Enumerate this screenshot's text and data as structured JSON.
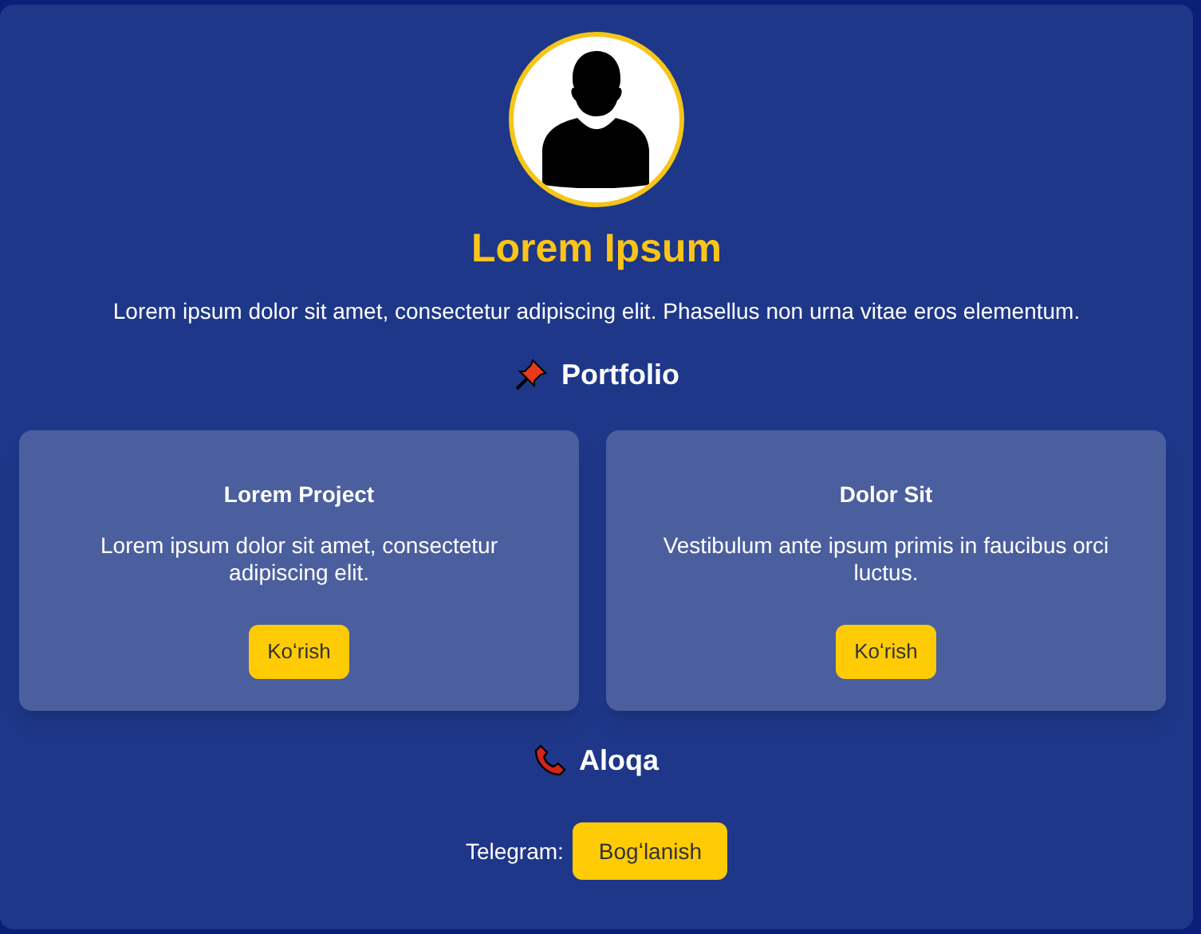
{
  "profile": {
    "name": "Lorem Ipsum",
    "bio": "Lorem ipsum dolor sit amet, consectetur adipiscing elit. Phasellus non urna vitae eros elementum."
  },
  "portfolio": {
    "heading": "Portfolio",
    "projects": [
      {
        "title": "Lorem Project",
        "description": "Lorem ipsum dolor sit amet, consectetur adipiscing elit.",
        "button": "Koʻrish"
      },
      {
        "title": "Dolor Sit",
        "description": "Vestibulum ante ipsum primis in faucibus orci luctus.",
        "button": "Koʻrish"
      }
    ]
  },
  "contact": {
    "heading": "Aloqa",
    "label": "Telegram:",
    "button": "Bogʻlanish"
  }
}
